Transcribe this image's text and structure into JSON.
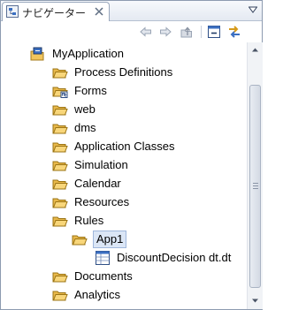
{
  "view": {
    "title": "ナビゲーター",
    "icons": {
      "tab": "navigator-icon",
      "close": "close-icon",
      "menu": "view-menu-icon"
    }
  },
  "toolbar": {
    "items": [
      {
        "name": "back-button",
        "icon": "back-arrow-icon"
      },
      {
        "name": "forward-button",
        "icon": "forward-arrow-icon"
      },
      {
        "name": "up-button",
        "icon": "up-icon"
      },
      {
        "name": "collapse-all-button",
        "icon": "collapse-all-icon"
      },
      {
        "name": "link-with-editor-button",
        "icon": "link-with-editor-icon"
      }
    ]
  },
  "tree": {
    "root": {
      "label": "MyApplication",
      "icon": "project-icon"
    },
    "items": [
      {
        "label": "Process Definitions",
        "icon": "folder-icon"
      },
      {
        "label": "Forms",
        "icon": "forms-folder-icon"
      },
      {
        "label": "web",
        "icon": "folder-icon"
      },
      {
        "label": "dms",
        "icon": "folder-icon"
      },
      {
        "label": "Application Classes",
        "icon": "folder-icon"
      },
      {
        "label": "Simulation",
        "icon": "folder-icon"
      },
      {
        "label": "Calendar",
        "icon": "folder-icon"
      },
      {
        "label": "Resources",
        "icon": "folder-icon"
      },
      {
        "label": "Rules",
        "icon": "folder-icon"
      },
      {
        "label": "App1",
        "icon": "open-folder-icon",
        "selected": true
      },
      {
        "label": "DiscountDecision dt.dt",
        "icon": "decision-table-icon"
      },
      {
        "label": "Documents",
        "icon": "folder-icon"
      },
      {
        "label": "Analytics",
        "icon": "folder-icon"
      }
    ]
  },
  "colors": {
    "folder": "#e8b84a",
    "selection": "#dbe6f6",
    "border": "#8d9bb0"
  }
}
